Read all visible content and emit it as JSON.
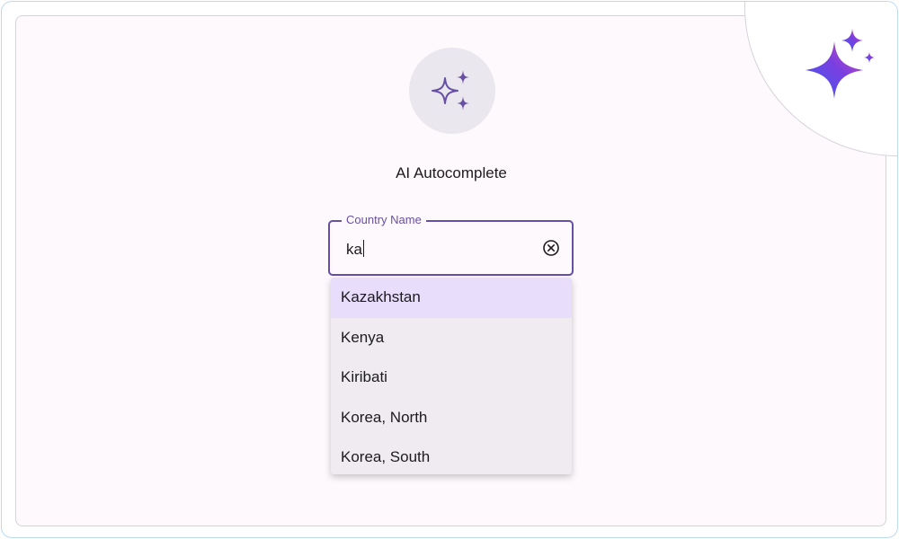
{
  "title": "AI Autocomplete",
  "field": {
    "label": "Country Name",
    "value": "ka"
  },
  "options": [
    "Kazakhstan",
    "Kenya",
    "Kiribati",
    "Korea, North",
    "Korea, South"
  ],
  "selected_option": "Kazakhstan",
  "icons": {
    "hero": "sparkles-icon",
    "clear": "clear-circle-icon",
    "corner": "ai-sparkle-icon"
  },
  "colors": {
    "accent": "#6750a4",
    "selected_option_bg": "#e8defb",
    "dropdown_bg": "#efebf1",
    "icon_circle_bg": "#ebe7ef",
    "gradient_start": "#3b5cf0",
    "gradient_mid": "#7a3fe0",
    "gradient_end": "#d94fb0"
  }
}
